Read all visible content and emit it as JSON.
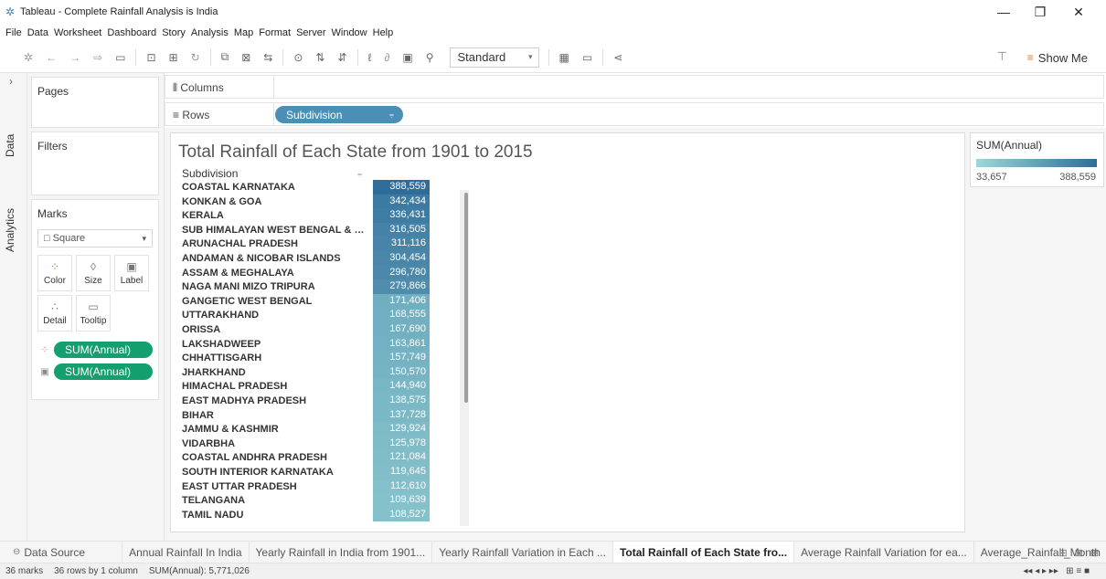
{
  "window": {
    "title": "Tableau - Complete Rainfall Analysis is India",
    "app_icon": "tableau-logo-icon"
  },
  "menu": [
    "File",
    "Data",
    "Worksheet",
    "Dashboard",
    "Story",
    "Analysis",
    "Map",
    "Format",
    "Server",
    "Window",
    "Help"
  ],
  "toolbar": {
    "fit_value": "Standard",
    "show_me_label": "Show Me"
  },
  "side_tabs": {
    "data": "Data",
    "analytics": "Analytics"
  },
  "cards": {
    "pages": "Pages",
    "filters": "Filters",
    "marks": "Marks",
    "mark_type": "Square",
    "buttons": {
      "color": "Color",
      "size": "Size",
      "label": "Label",
      "detail": "Detail",
      "tooltip": "Tooltip"
    },
    "pills": [
      "SUM(Annual)",
      "SUM(Annual)"
    ]
  },
  "shelves": {
    "columns_label": "Columns",
    "rows_label": "Rows",
    "rows_pill": "Subdivision"
  },
  "worksheet": {
    "title": "Total Rainfall of Each State from 1901 to 2015",
    "column_header": "Subdivision"
  },
  "legend": {
    "title": "SUM(Annual)",
    "min": "33,657",
    "max": "388,559",
    "color_low": "#9bd8d8",
    "color_high": "#2f6c99"
  },
  "chart_data": {
    "type": "table",
    "row_header": "Subdivision",
    "measure": "SUM(Annual)",
    "rows": [
      {
        "label": "COASTAL KARNATAKA",
        "value": 388559,
        "text": "388,559"
      },
      {
        "label": "KONKAN & GOA",
        "value": 342434,
        "text": "342,434"
      },
      {
        "label": "KERALA",
        "value": 336431,
        "text": "336,431"
      },
      {
        "label": "SUB HIMALAYAN WEST BENGAL & SIK..",
        "value": 316505,
        "text": "316,505"
      },
      {
        "label": "ARUNACHAL PRADESH",
        "value": 311116,
        "text": "311,116"
      },
      {
        "label": "ANDAMAN & NICOBAR ISLANDS",
        "value": 304454,
        "text": "304,454"
      },
      {
        "label": "ASSAM & MEGHALAYA",
        "value": 296780,
        "text": "296,780"
      },
      {
        "label": "NAGA MANI MIZO TRIPURA",
        "value": 279866,
        "text": "279,866"
      },
      {
        "label": "GANGETIC WEST BENGAL",
        "value": 171406,
        "text": "171,406"
      },
      {
        "label": "UTTARAKHAND",
        "value": 168555,
        "text": "168,555"
      },
      {
        "label": "ORISSA",
        "value": 167690,
        "text": "167,690"
      },
      {
        "label": "LAKSHADWEEP",
        "value": 163861,
        "text": "163,861"
      },
      {
        "label": "CHHATTISGARH",
        "value": 157749,
        "text": "157,749"
      },
      {
        "label": "JHARKHAND",
        "value": 150570,
        "text": "150,570"
      },
      {
        "label": "HIMACHAL PRADESH",
        "value": 144940,
        "text": "144,940"
      },
      {
        "label": "EAST MADHYA PRADESH",
        "value": 138575,
        "text": "138,575"
      },
      {
        "label": "BIHAR",
        "value": 137728,
        "text": "137,728"
      },
      {
        "label": "JAMMU & KASHMIR",
        "value": 129924,
        "text": "129,924"
      },
      {
        "label": "VIDARBHA",
        "value": 125978,
        "text": "125,978"
      },
      {
        "label": "COASTAL ANDHRA PRADESH",
        "value": 121084,
        "text": "121,084"
      },
      {
        "label": "SOUTH INTERIOR KARNATAKA",
        "value": 119645,
        "text": "119,645"
      },
      {
        "label": "EAST UTTAR PRADESH",
        "value": 112610,
        "text": "112,610"
      },
      {
        "label": "TELANGANA",
        "value": 109639,
        "text": "109,639"
      },
      {
        "label": "TAMIL NADU",
        "value": 108527,
        "text": "108,527"
      }
    ]
  },
  "sheet_tabs": [
    {
      "label": "Data Source",
      "active": false
    },
    {
      "label": "Annual Rainfall In India",
      "active": false
    },
    {
      "label": "Yearly Rainfall in India from 1901...",
      "active": false
    },
    {
      "label": "Yearly Rainfall Variation in Each ...",
      "active": false
    },
    {
      "label": "Total Rainfall of Each State fro...",
      "active": true
    },
    {
      "label": "Average Rainfall Variation for ea...",
      "active": false
    },
    {
      "label": "Average_Rainfall_Month",
      "active": false
    }
  ],
  "status": {
    "marks": "36 marks",
    "dims": "36 rows by 1 column",
    "sum": "SUM(Annual): 5,771,026"
  }
}
